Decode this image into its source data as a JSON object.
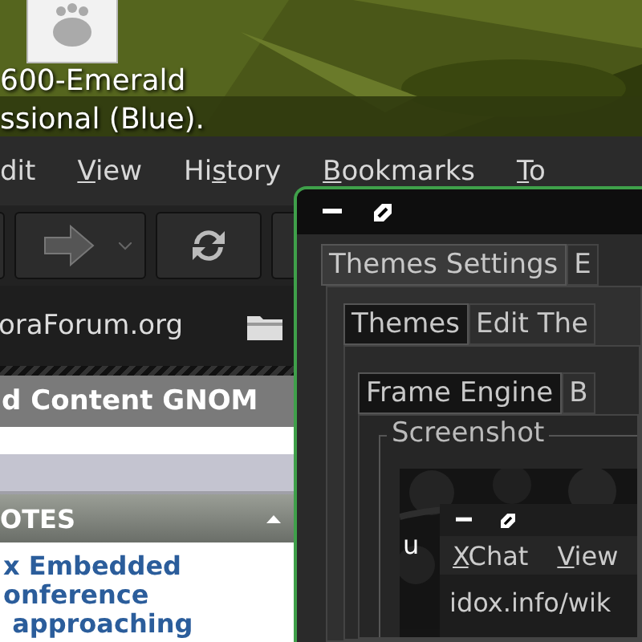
{
  "desktop": {
    "icon_label": [
      "600-Emerald",
      "ssional (Blue)."
    ]
  },
  "browser": {
    "menu": [
      {
        "pre": "dit"
      },
      {
        "key": "V",
        "post": "iew"
      },
      {
        "pre": "Hi",
        "key": "s",
        "post": "tory"
      },
      {
        "key": "B",
        "post": "ookmarks"
      },
      {
        "key": "T",
        "post": "o"
      }
    ],
    "url": "oraForum.org",
    "heading": "d Content GNOM",
    "sidebar": {
      "title": "OTES",
      "links": [
        "x Embedded",
        "onference",
        " approaching"
      ]
    }
  },
  "dialog": {
    "tabs": [
      {
        "label": "Themes Settings",
        "selected": true
      },
      {
        "label": "E",
        "selected": false
      }
    ],
    "inner_tabs": [
      {
        "label": "Themes",
        "selected": true
      },
      {
        "label": "Edit The",
        "selected": false
      }
    ],
    "engine_tabs": [
      {
        "label": "Frame Engine",
        "selected": true
      },
      {
        "label": "B",
        "selected": false
      }
    ],
    "frame_label": "Screenshot",
    "preview": {
      "side_text": "u",
      "menu": [
        {
          "key": "X",
          "post": "Chat"
        },
        {
          "key": "V",
          "post": "iew"
        }
      ],
      "url": "idox.info/wik"
    }
  }
}
